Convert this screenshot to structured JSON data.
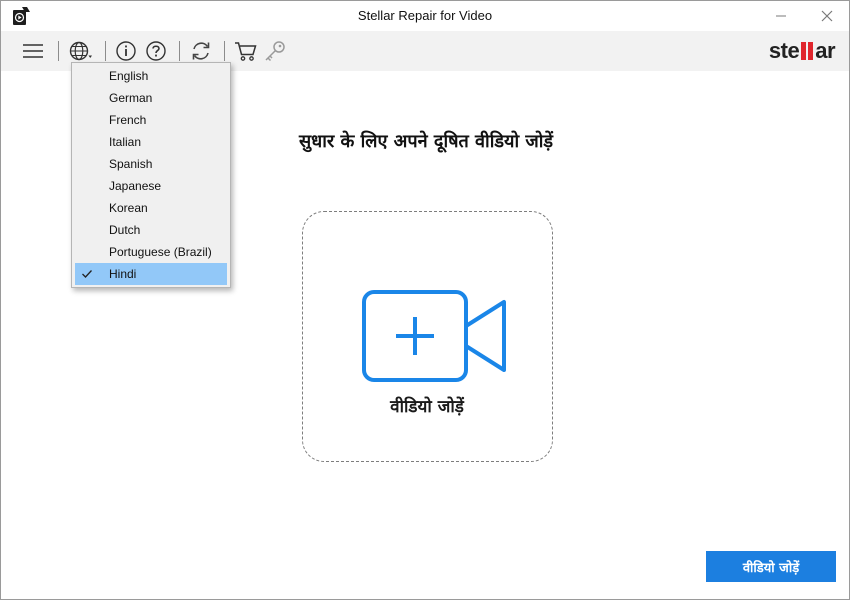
{
  "window": {
    "title": "Stellar Repair for Video"
  },
  "toolbar": {
    "brand": {
      "left": "ste",
      "right": "ar"
    }
  },
  "main": {
    "heading": "सुधार के लिए अपने दूषित वीडियो जोड़ें",
    "drop_label": "वीडियो जोड़ें",
    "add_button_label": "वीडियो जोड़ें"
  },
  "language_menu": {
    "items": [
      {
        "label": "English"
      },
      {
        "label": "German"
      },
      {
        "label": "French"
      },
      {
        "label": "Italian"
      },
      {
        "label": "Spanish"
      },
      {
        "label": "Japanese"
      },
      {
        "label": "Korean"
      },
      {
        "label": "Dutch"
      },
      {
        "label": "Portuguese (Brazil)"
      },
      {
        "label": "Hindi",
        "selected": true
      }
    ]
  },
  "colors": {
    "accent": "#1c7fe0",
    "icon_blue": "#1a86e8",
    "brand_red": "#e0262d",
    "selected_item": "#92c8f8"
  }
}
